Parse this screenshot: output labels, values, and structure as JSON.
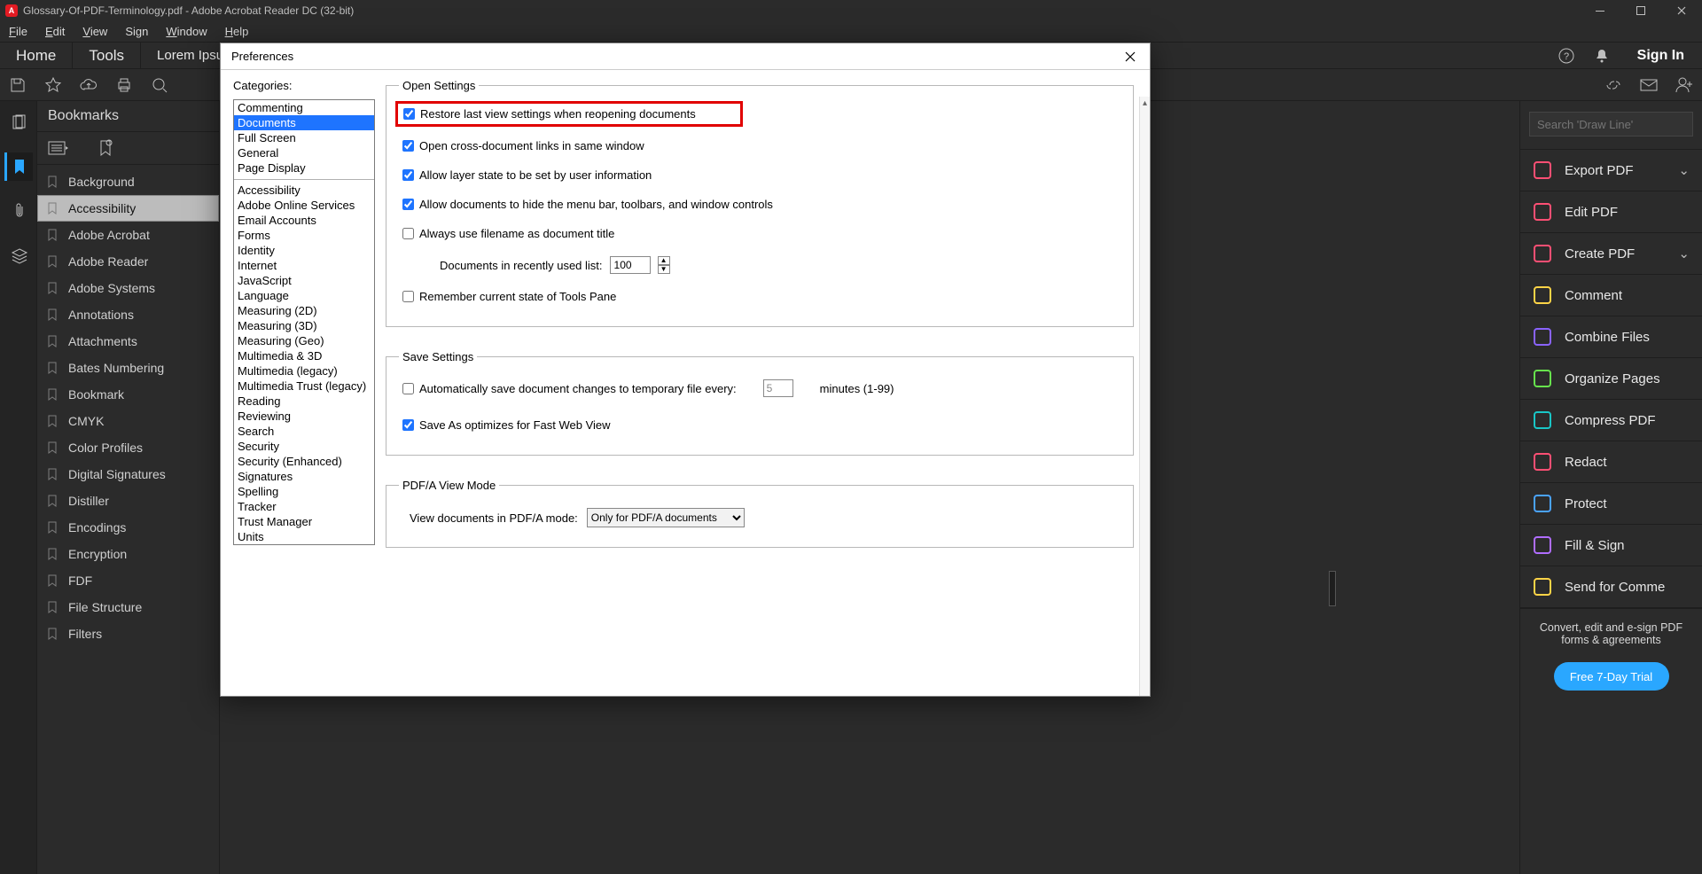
{
  "title": "Glossary-Of-PDF-Terminology.pdf - Adobe Acrobat Reader DC (32-bit)",
  "menubar": [
    "File",
    "Edit",
    "View",
    "Sign",
    "Window",
    "Help"
  ],
  "home": "Home",
  "tools": "Tools",
  "doc_tab": "Lorem Ipsum",
  "signin": "Sign In",
  "bookmarks": {
    "title": "Bookmarks",
    "items": [
      "Background",
      "Accessibility",
      "Adobe Acrobat",
      "Adobe Reader",
      "Adobe Systems",
      "Annotations",
      "Attachments",
      "Bates Numbering",
      "Bookmark",
      "CMYK",
      "Color Profiles",
      "Digital Signatures",
      "Distiller",
      "Encodings",
      "Encryption",
      "FDF",
      "File Structure",
      "Filters"
    ],
    "selected_index": 1
  },
  "rightpanel": {
    "search_placeholder": "Search 'Draw Line'",
    "tools": [
      {
        "label": "Export PDF",
        "color": "#ff4f74",
        "expand": true
      },
      {
        "label": "Edit PDF",
        "color": "#ff4f74"
      },
      {
        "label": "Create PDF",
        "color": "#ff4f74",
        "expand": true
      },
      {
        "label": "Comment",
        "color": "#ffd447"
      },
      {
        "label": "Combine Files",
        "color": "#8a63ff"
      },
      {
        "label": "Organize Pages",
        "color": "#67e24d"
      },
      {
        "label": "Compress PDF",
        "color": "#19c6c6"
      },
      {
        "label": "Redact",
        "color": "#ff4f74"
      },
      {
        "label": "Protect",
        "color": "#4aa3ff"
      },
      {
        "label": "Fill & Sign",
        "color": "#b06dff"
      },
      {
        "label": "Send for Comme",
        "color": "#ffd447"
      }
    ],
    "promo": "Convert, edit and e-sign PDF forms & agreements",
    "trial": "Free 7-Day Trial"
  },
  "dialog": {
    "title": "Preferences",
    "cat_label": "Categories:",
    "categories_top": [
      "Commenting",
      "Documents",
      "Full Screen",
      "General",
      "Page Display"
    ],
    "categories_rest": [
      "Accessibility",
      "Adobe Online Services",
      "Email Accounts",
      "Forms",
      "Identity",
      "Internet",
      "JavaScript",
      "Language",
      "Measuring (2D)",
      "Measuring (3D)",
      "Measuring (Geo)",
      "Multimedia & 3D",
      "Multimedia (legacy)",
      "Multimedia Trust (legacy)",
      "Reading",
      "Reviewing",
      "Search",
      "Security",
      "Security (Enhanced)",
      "Signatures",
      "Spelling",
      "Tracker",
      "Trust Manager",
      "Units"
    ],
    "selected_category": "Documents",
    "open_settings": {
      "legend": "Open Settings",
      "restore": "Restore last view settings when reopening documents",
      "cross_doc": "Open cross-document links in same window",
      "layer": "Allow layer state to be set by user information",
      "hide_menu": "Allow documents to hide the menu bar, toolbars, and window controls",
      "filename_title": "Always use filename as document title",
      "recent_label": "Documents in recently used list:",
      "recent_value": "100",
      "remember_tools": "Remember current state of Tools Pane"
    },
    "save_settings": {
      "legend": "Save Settings",
      "auto_save": "Automatically save document changes to temporary file every:",
      "auto_save_value": "5",
      "auto_save_unit": "minutes (1-99)",
      "fast_web": "Save As optimizes for Fast Web View"
    },
    "pdfa": {
      "legend": "PDF/A View Mode",
      "label": "View documents in PDF/A mode:",
      "value": "Only for PDF/A documents"
    }
  }
}
